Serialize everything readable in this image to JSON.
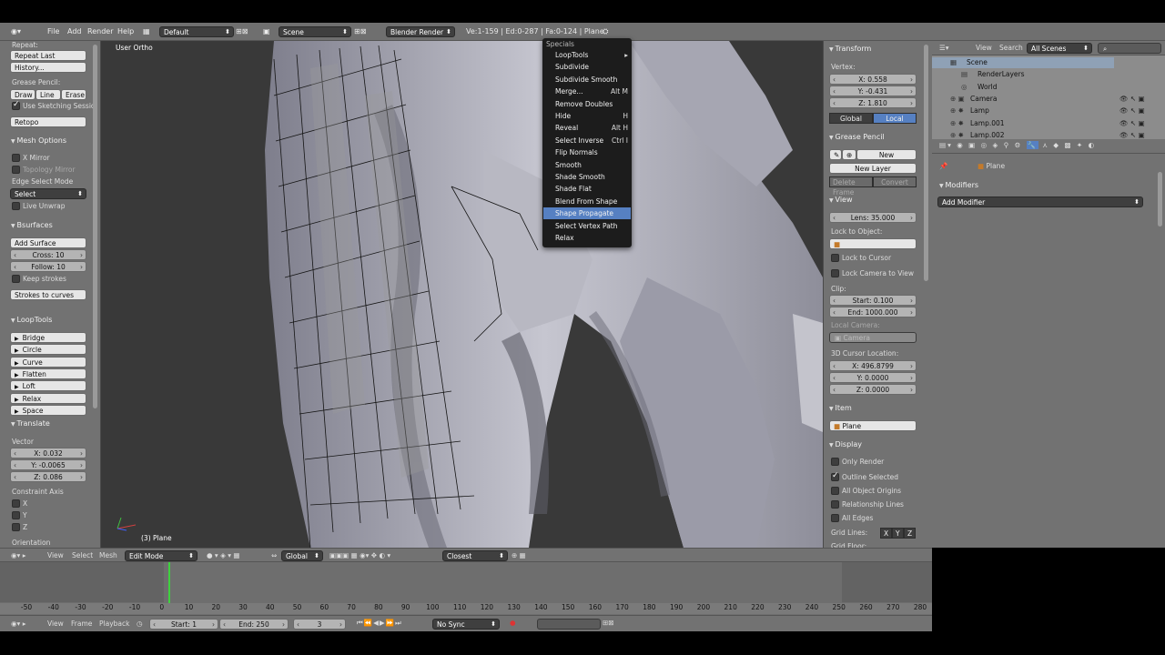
{
  "top_header": {
    "menus": [
      "File",
      "Add",
      "Render",
      "Help"
    ],
    "screen_layout": "Default",
    "scene": "Scene",
    "engine": "Blender Render",
    "stats": "Ve:1-159 | Ed:0-287 | Fa:0-124 | Plane"
  },
  "toolshelf": {
    "repeat_title": "Repeat:",
    "repeat_last": "Repeat Last",
    "history": "History...",
    "grease_pencil": "Grease Pencil:",
    "gp_buttons": [
      "Draw",
      "Line",
      "Erase"
    ],
    "use_sketching": "Use Sketching Sessio",
    "retopo": "Retopo",
    "mesh_options": "Mesh Options",
    "x_mirror": "X Mirror",
    "topology_mirror": "Topology Mirror",
    "edge_select_mode": "Edge Select Mode",
    "select_value": "Select",
    "live_unwrap": "Live Unwrap",
    "bsurfaces": "Bsurfaces",
    "add_surface": "Add Surface",
    "cross": "Cross: 10",
    "follow": "Follow: 10",
    "keep_strokes": "Keep strokes",
    "strokes_to_curves": "Strokes to curves",
    "looptools": "LoopTools",
    "looptools_items": [
      "Bridge",
      "Circle",
      "Curve",
      "Flatten",
      "Loft",
      "Relax",
      "Space"
    ],
    "translate": "Translate",
    "vector_label": "Vector",
    "vector": [
      "X: 0.032",
      "Y: -0.0065",
      "Z: 0.086"
    ],
    "constraint_axis": "Constraint Axis",
    "axes": [
      "X",
      "Y",
      "Z"
    ],
    "orientation": "Orientation"
  },
  "viewport": {
    "view_label": "User Ortho",
    "object_label": "(3) Plane"
  },
  "specials_menu": {
    "title": "Specials",
    "items": [
      {
        "label": "LoopTools",
        "shortcut": "",
        "submenu": true
      },
      {
        "label": "Subdivide",
        "shortcut": ""
      },
      {
        "label": "Subdivide Smooth",
        "shortcut": ""
      },
      {
        "label": "Merge...",
        "shortcut": "Alt M"
      },
      {
        "label": "Remove Doubles",
        "shortcut": ""
      },
      {
        "label": "Hide",
        "shortcut": "H"
      },
      {
        "label": "Reveal",
        "shortcut": "Alt H"
      },
      {
        "label": "Select Inverse",
        "shortcut": "Ctrl I"
      },
      {
        "label": "Flip Normals",
        "shortcut": ""
      },
      {
        "label": "Smooth",
        "shortcut": ""
      },
      {
        "label": "Shade Smooth",
        "shortcut": ""
      },
      {
        "label": "Shade Flat",
        "shortcut": ""
      },
      {
        "label": "Blend From Shape",
        "shortcut": ""
      },
      {
        "label": "Shape Propagate",
        "shortcut": "",
        "highlighted": true
      },
      {
        "label": "Select Vertex Path",
        "shortcut": ""
      },
      {
        "label": "Relax",
        "shortcut": ""
      }
    ]
  },
  "properties_n": {
    "transform": "Transform",
    "vertex_label": "Vertex:",
    "vertex": [
      "X: 0.558",
      "Y: -0.431",
      "Z: 1.810"
    ],
    "global": "Global",
    "local": "Local",
    "grease_pencil": "Grease Pencil",
    "new": "New",
    "new_layer": "New Layer",
    "delete_frame": "Delete Frame",
    "convert": "Convert",
    "view": "View",
    "lens": "Lens: 35.000",
    "lock_to_object": "Lock to Object:",
    "lock_to_cursor": "Lock to Cursor",
    "lock_camera": "Lock Camera to View",
    "clip": "Clip:",
    "clip_start": "Start: 0.100",
    "clip_end": "End: 1000.000",
    "local_camera": "Local Camera:",
    "camera": "Camera",
    "cursor_loc": "3D Cursor Location:",
    "cursor": [
      "X: 496.8799",
      "Y: 0.0000",
      "Z: 0.0000"
    ],
    "item": "Item",
    "item_name": "Plane",
    "display": "Display",
    "only_render": "Only Render",
    "outline_selected": "Outline Selected",
    "all_object_origins": "All Object Origins",
    "relationship_lines": "Relationship Lines",
    "all_edges": "All Edges",
    "grid_lines": "Grid Lines:",
    "grid_axes": [
      "X",
      "Y",
      "Z"
    ],
    "grid_floor": "Grid Floor:"
  },
  "outliner": {
    "view": "View",
    "search": "Search",
    "filter": "All Scenes",
    "items": [
      "Scene",
      "RenderLayers",
      "World",
      "Camera",
      "Lamp",
      "Lamp.001",
      "Lamp.002"
    ]
  },
  "properties_editor": {
    "object": "Plane",
    "modifiers": "Modifiers",
    "add_modifier": "Add Modifier"
  },
  "viewport_header": {
    "view": "View",
    "select": "Select",
    "mesh": "Mesh",
    "mode": "Edit Mode",
    "orientation": "Global",
    "snap": "Closest"
  },
  "timeline": {
    "ticks": [
      "-50",
      "-40",
      "-30",
      "-20",
      "-10",
      "0",
      "10",
      "20",
      "30",
      "40",
      "50",
      "60",
      "70",
      "80",
      "90",
      "100",
      "110",
      "120",
      "130",
      "140",
      "150",
      "160",
      "170",
      "180",
      "190",
      "200",
      "210",
      "220",
      "230",
      "240",
      "250",
      "260",
      "270",
      "280"
    ],
    "view": "View",
    "frame": "Frame",
    "playback": "Playback",
    "start": "Start: 1",
    "end": "End: 250",
    "current": "3",
    "sync": "No Sync"
  },
  "colors": {
    "ui_bg": "#727272",
    "viewport_bg": "#393939",
    "highlight": "#5680c2",
    "frame_marker": "#3fd13f"
  }
}
